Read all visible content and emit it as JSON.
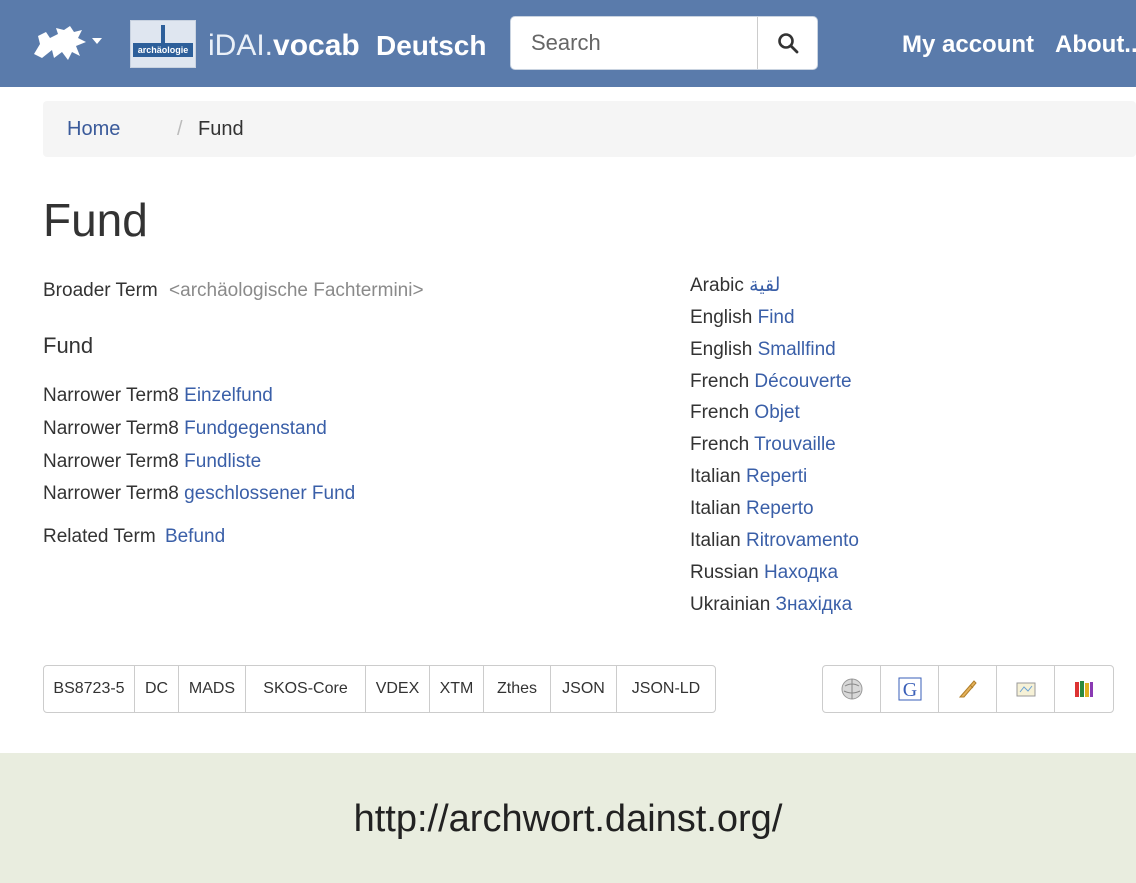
{
  "navbar": {
    "brand_prefix": "iDAI.",
    "brand_bold": "vocab",
    "language": "Deutsch",
    "search_placeholder": "Search",
    "links": [
      "My account",
      "About..."
    ],
    "color": "#5a7bab"
  },
  "breadcrumb": {
    "home": "Home",
    "separator": "/",
    "current": "Fund"
  },
  "term": {
    "title": "Fund",
    "broader_label": "Broader Term",
    "broader_value": "<archäologische Fachtermini>",
    "preferred_label": "Fund",
    "narrower": [
      {
        "label": "Narrower Term8",
        "value": "Einzelfund"
      },
      {
        "label": "Narrower Term8",
        "value": "Fundgegenstand"
      },
      {
        "label": "Narrower Term8",
        "value": "Fundliste"
      },
      {
        "label": "Narrower Term8",
        "value": "geschlossener Fund"
      }
    ],
    "related_label": "Related Term",
    "related_value": "Befund"
  },
  "translations": [
    {
      "lang": "Arabic",
      "value": "لقية"
    },
    {
      "lang": "English",
      "value": "Find"
    },
    {
      "lang": "English",
      "value": "Smallfind"
    },
    {
      "lang": "French",
      "value": "Découverte"
    },
    {
      "lang": "French",
      "value": "Objet"
    },
    {
      "lang": "French",
      "value": "Trouvaille"
    },
    {
      "lang": "Italian",
      "value": "Reperti"
    },
    {
      "lang": "Italian",
      "value": "Reperto"
    },
    {
      "lang": "Italian",
      "value": "Ritrovamento"
    },
    {
      "lang": "Russian",
      "value": "Находка"
    },
    {
      "lang": "Ukrainian",
      "value": "Знахідка"
    }
  ],
  "formats": [
    "BS8723-5",
    "DC",
    "MADS",
    "SKOS-Core",
    "VDEX",
    "XTM",
    "Zthes",
    "JSON",
    "JSON-LD"
  ],
  "external_icons": [
    "wikipedia-icon",
    "google-icon",
    "quill-icon",
    "map-icon",
    "books-icon"
  ],
  "footer_url": "http://archwort.dainst.org/"
}
